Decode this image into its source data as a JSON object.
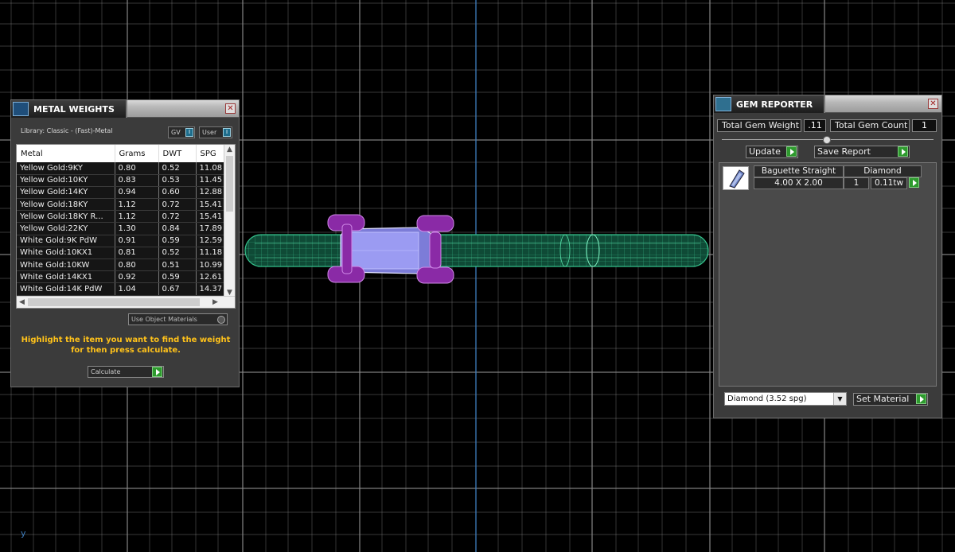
{
  "colors": {
    "grid": "#8a8a8a",
    "axis_v": "#3f7fbf",
    "band": "#2a9a6a",
    "gem": "#8d8df0",
    "prongs": "#9b2fb0",
    "hint_text": "#ffc21a",
    "action_arrow": "#2e9a2e"
  },
  "viewport": {
    "axis_label": "y"
  },
  "metal_weights": {
    "title": "METAL WEIGHTS",
    "close_icon": "close-icon",
    "library_label": "Library: Classic - (Fast)-Metal",
    "toggle_gv": "GV",
    "toggle_user": "User",
    "columns": [
      "Metal",
      "Grams",
      "DWT",
      "SPG"
    ],
    "rows": [
      [
        "Yellow Gold:9KY",
        "0.80",
        "0.52",
        "11.08"
      ],
      [
        "Yellow Gold:10KY",
        "0.83",
        "0.53",
        "11.45"
      ],
      [
        "Yellow Gold:14KY",
        "0.94",
        "0.60",
        "12.88"
      ],
      [
        "Yellow Gold:18KY",
        "1.12",
        "0.72",
        "15.41"
      ],
      [
        "Yellow Gold:18KY R...",
        "1.12",
        "0.72",
        "15.41"
      ],
      [
        "Yellow Gold:22KY",
        "1.30",
        "0.84",
        "17.89"
      ],
      [
        "White Gold:9K PdW",
        "0.91",
        "0.59",
        "12.59"
      ],
      [
        "White Gold:10KX1",
        "0.81",
        "0.52",
        "11.18"
      ],
      [
        "White Gold:10KW",
        "0.80",
        "0.51",
        "10.99"
      ],
      [
        "White Gold:14KX1",
        "0.92",
        "0.59",
        "12.61"
      ],
      [
        "White Gold:14K PdW",
        "1.04",
        "0.67",
        "14.37"
      ]
    ],
    "use_object_materials": "Use Object Materials",
    "hint": "Highlight the item you want to find the weight for then press calculate.",
    "calculate_label": "Calculate"
  },
  "gem_reporter": {
    "title": "GEM REPORTER",
    "total_weight_label": "Total Gem Weight",
    "total_weight_value": ".11",
    "total_count_label": "Total Gem Count",
    "total_count_value": "1",
    "update_label": "Update",
    "save_report_label": "Save Report",
    "gems": [
      {
        "shape": "Baguette Straight",
        "material": "Diamond",
        "size": "4.00 X 2.00",
        "count": "1",
        "weight": "0.11tw"
      }
    ],
    "material_select": "Diamond     (3.52 spg)",
    "set_material_label": "Set Material"
  }
}
